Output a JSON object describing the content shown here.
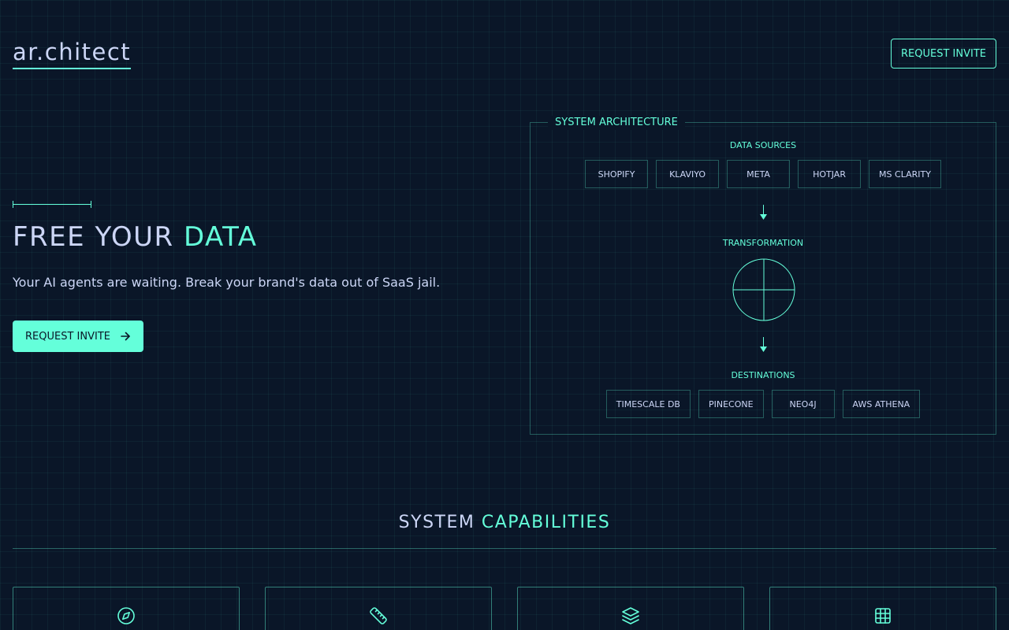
{
  "brand": {
    "logo_text": "ar.chitect"
  },
  "header": {
    "cta_label": "REQUEST INVITE"
  },
  "hero": {
    "title_part1": "FREE YOUR ",
    "title_part2": "DATA",
    "subtitle": "Your AI agents are waiting. Break your brand's data out of SaaS jail.",
    "cta_label": "REQUEST INVITE",
    "cta_icon": "arrow-right-icon"
  },
  "architecture": {
    "title": "SYSTEM ARCHITECTURE",
    "sources_label": "DATA SOURCES",
    "sources": [
      "SHOPIFY",
      "KLAVIYO",
      "META",
      "HOTJAR",
      "MS CLARITY"
    ],
    "transformation_label": "TRANSFORMATION",
    "destinations_label": "DESTINATIONS",
    "destinations": [
      "TIMESCALE DB",
      "PINECONE",
      "NEO4J",
      "AWS ATHENA"
    ]
  },
  "capabilities": {
    "title_part1": "SYSTEM ",
    "title_part2": "CAPABILITIES",
    "card_icons": [
      "compass-icon",
      "ruler-icon",
      "layers-icon",
      "grid-icon"
    ]
  },
  "colors": {
    "background": "#0a1628",
    "accent": "#64ffda",
    "text": "#ccd6f6"
  }
}
